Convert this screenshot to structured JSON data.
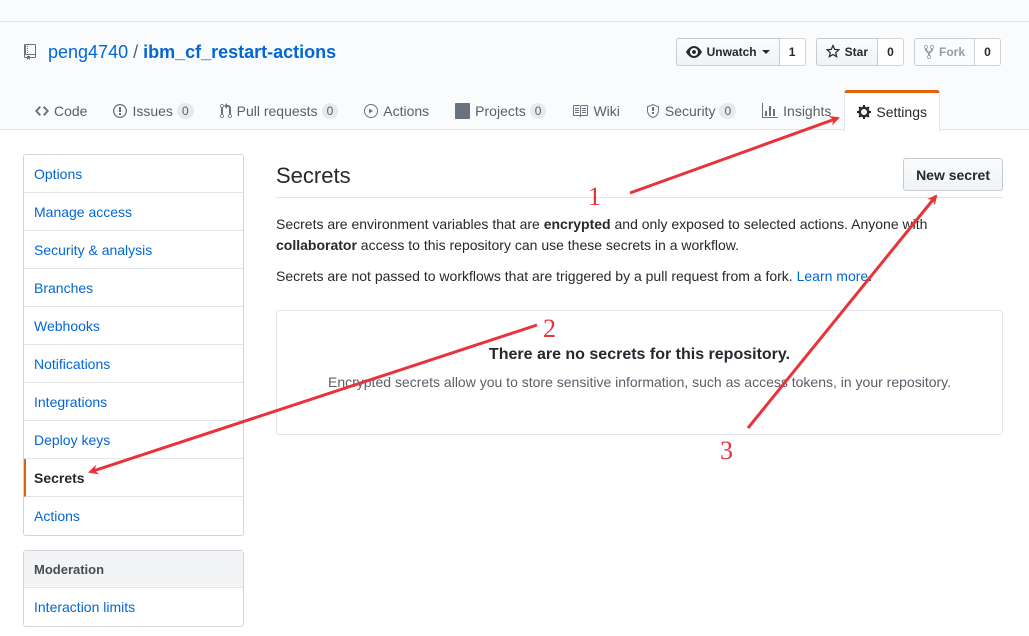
{
  "repo": {
    "owner": "peng4740",
    "separator": "/",
    "name": "ibm_cf_restart-actions"
  },
  "actions": {
    "watch_label": "Unwatch",
    "watch_count": "1",
    "star_label": "Star",
    "star_count": "0",
    "fork_label": "Fork",
    "fork_count": "0"
  },
  "tabs": [
    {
      "label": "Code",
      "counter": ""
    },
    {
      "label": "Issues",
      "counter": "0"
    },
    {
      "label": "Pull requests",
      "counter": "0"
    },
    {
      "label": "Actions",
      "counter": ""
    },
    {
      "label": "Projects",
      "counter": "0"
    },
    {
      "label": "Wiki",
      "counter": ""
    },
    {
      "label": "Security",
      "counter": "0"
    },
    {
      "label": "Insights",
      "counter": ""
    },
    {
      "label": "Settings",
      "counter": ""
    }
  ],
  "sidebar": {
    "items": [
      {
        "label": "Options"
      },
      {
        "label": "Manage access"
      },
      {
        "label": "Security & analysis"
      },
      {
        "label": "Branches"
      },
      {
        "label": "Webhooks"
      },
      {
        "label": "Notifications"
      },
      {
        "label": "Integrations"
      },
      {
        "label": "Deploy keys"
      },
      {
        "label": "Secrets"
      },
      {
        "label": "Actions"
      }
    ],
    "moderation_heading": "Moderation",
    "moderation_items": [
      {
        "label": "Interaction limits"
      }
    ]
  },
  "main": {
    "title": "Secrets",
    "new_button": "New secret",
    "desc1_a": "Secrets are environment variables that are ",
    "desc1_b": "encrypted",
    "desc1_c": " and only exposed to selected actions. Anyone with ",
    "desc1_d": "collaborator",
    "desc1_e": " access to this repository can use these secrets in a workflow.",
    "desc2_a": "Secrets are not passed to workflows that are triggered by a pull request from a fork. ",
    "desc2_link": "Learn more",
    "desc2_b": ".",
    "empty_title": "There are no secrets for this repository.",
    "empty_text": "Encrypted secrets allow you to store sensitive information, such as access tokens, in your repository."
  },
  "annotations": {
    "n1": "1",
    "n2": "2",
    "n3": "3",
    "arrow_color": "#e8333a"
  },
  "colors": {
    "link": "#0366d6",
    "selected_accent": "#e36209"
  }
}
